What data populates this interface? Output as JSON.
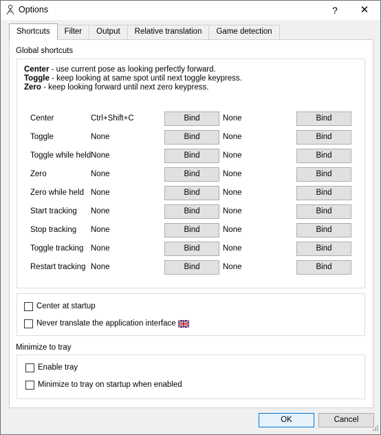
{
  "window": {
    "title": "Options",
    "help": "?",
    "close": "✕"
  },
  "tabs": [
    {
      "label": "Shortcuts",
      "active": true
    },
    {
      "label": "Filter"
    },
    {
      "label": "Output"
    },
    {
      "label": "Relative translation"
    },
    {
      "label": "Game detection"
    }
  ],
  "global_shortcuts": {
    "heading": "Global shortcuts",
    "help": [
      {
        "key": "Center",
        "text": " - use current pose as looking perfectly forward."
      },
      {
        "key": "Toggle",
        "text": " - keep looking at same spot until next toggle keypress."
      },
      {
        "key": "Zero",
        "text": " - keep looking forward until next zero keypress."
      }
    ],
    "bind_label": "Bind",
    "rows": [
      {
        "label": "Center",
        "key1": "Ctrl+Shift+C",
        "key2": "None"
      },
      {
        "label": "Toggle",
        "key1": "None",
        "key2": "None"
      },
      {
        "label": "Toggle while held",
        "key1": "None",
        "key2": "None"
      },
      {
        "label": "Zero",
        "key1": "None",
        "key2": "None"
      },
      {
        "label": "Zero while held",
        "key1": "None",
        "key2": "None"
      },
      {
        "label": "Start tracking",
        "key1": "None",
        "key2": "None"
      },
      {
        "label": "Stop tracking",
        "key1": "None",
        "key2": "None"
      },
      {
        "label": "Toggle tracking",
        "key1": "None",
        "key2": "None"
      },
      {
        "label": "Restart tracking",
        "key1": "None",
        "key2": "None"
      }
    ]
  },
  "startup": {
    "center_at_startup": {
      "label": "Center at startup",
      "checked": false
    },
    "never_translate": {
      "label": "Never translate the application interface",
      "checked": false
    }
  },
  "tray": {
    "heading": "Minimize to tray",
    "enable_tray": {
      "label": "Enable tray",
      "checked": false
    },
    "minimize_on_startup": {
      "label": "Minimize to tray on startup when enabled",
      "checked": false
    }
  },
  "footer": {
    "ok": "OK",
    "cancel": "Cancel"
  }
}
